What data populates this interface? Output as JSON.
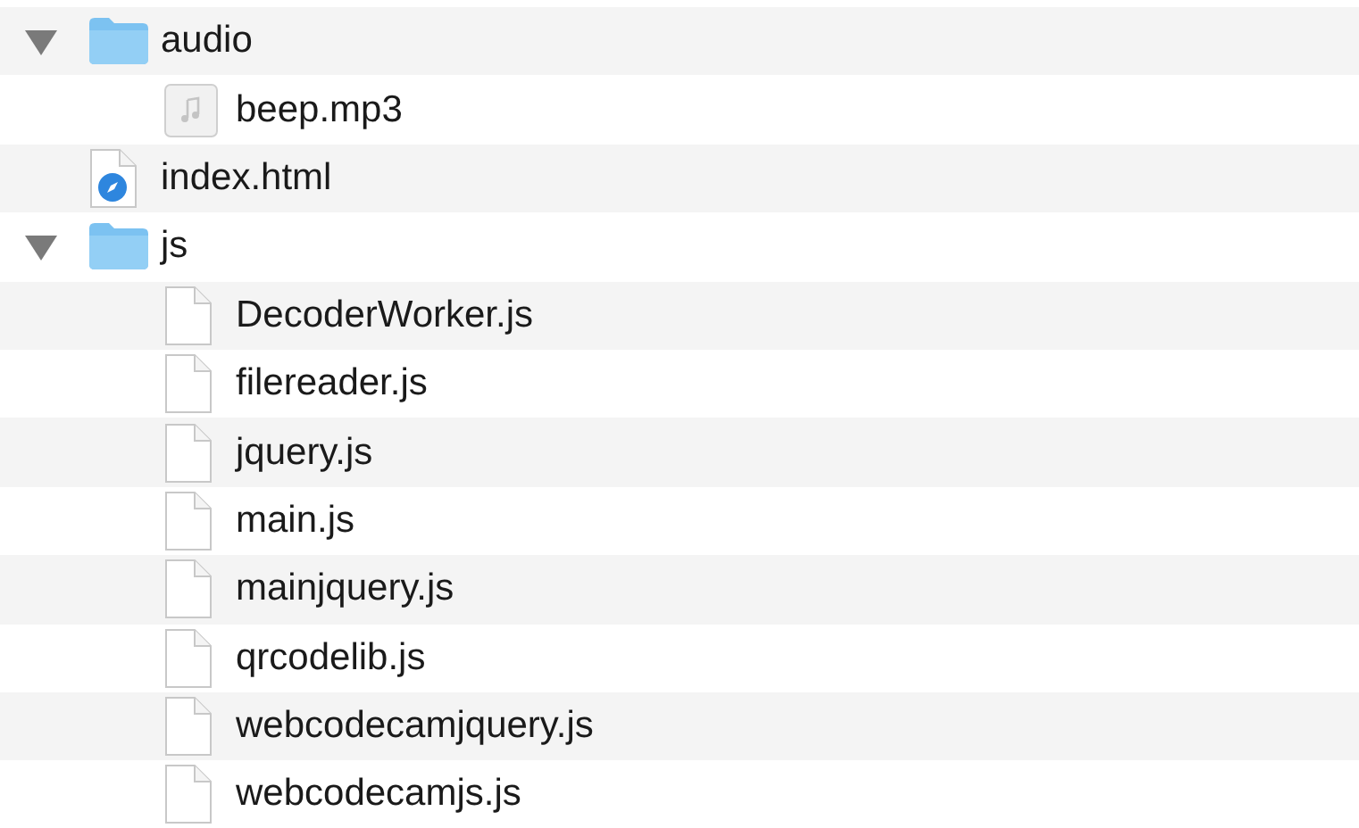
{
  "items": [
    {
      "name": "audio",
      "kind": "folder",
      "expanded": true,
      "children": [
        {
          "name": "beep.mp3",
          "kind": "audio"
        }
      ]
    },
    {
      "name": "index.html",
      "kind": "html"
    },
    {
      "name": "js",
      "kind": "folder",
      "expanded": true,
      "children": [
        {
          "name": "DecoderWorker.js",
          "kind": "file"
        },
        {
          "name": "filereader.js",
          "kind": "file"
        },
        {
          "name": "jquery.js",
          "kind": "file"
        },
        {
          "name": "main.js",
          "kind": "file"
        },
        {
          "name": "mainjquery.js",
          "kind": "file"
        },
        {
          "name": "qrcodelib.js",
          "kind": "file"
        },
        {
          "name": "webcodecamjquery.js",
          "kind": "file"
        },
        {
          "name": "webcodecamjs.js",
          "kind": "file"
        }
      ]
    }
  ]
}
